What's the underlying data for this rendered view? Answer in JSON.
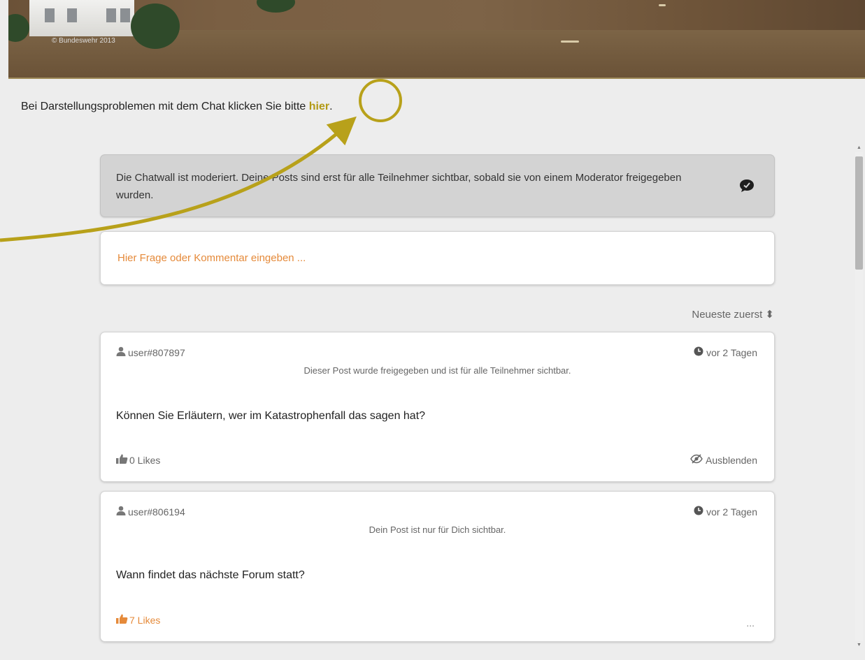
{
  "banner": {
    "copyright": "© Bundeswehr 2013"
  },
  "notice": {
    "text": "Bei Darstellungsproblemen mit dem Chat klicken Sie bitte ",
    "link": "hier",
    "end": "."
  },
  "moderation": {
    "text": "Die Chatwall ist moderiert. Deine Posts sind erst für alle Teilnehmer sichtbar, sobald sie von einem Moderator freigegeben wurden.",
    "icon": "chat-bubble-icon"
  },
  "composer": {
    "placeholder": "Hier Frage oder Kommentar eingeben ..."
  },
  "sort": {
    "label": "Neueste zuerst"
  },
  "posts": [
    {
      "user": "user#807897",
      "time": "vor 2 Tagen",
      "status": "Dieser Post wurde freigegeben und ist für alle Teilnehmer sichtbar.",
      "body": "Können Sie Erläutern, wer im Katastrophenfall das sagen hat?",
      "likes": "0 Likes",
      "hide": "Ausblenden"
    },
    {
      "user": "user#806194",
      "time": "vor 2 Tagen",
      "status": "Dein Post ist nur für Dich sichtbar.",
      "body": "Wann findet das nächste Forum statt?",
      "likes": "7 Likes",
      "more": "..."
    }
  ],
  "colors": {
    "accent": "#b8a11a",
    "orange": "#e58a3a"
  }
}
